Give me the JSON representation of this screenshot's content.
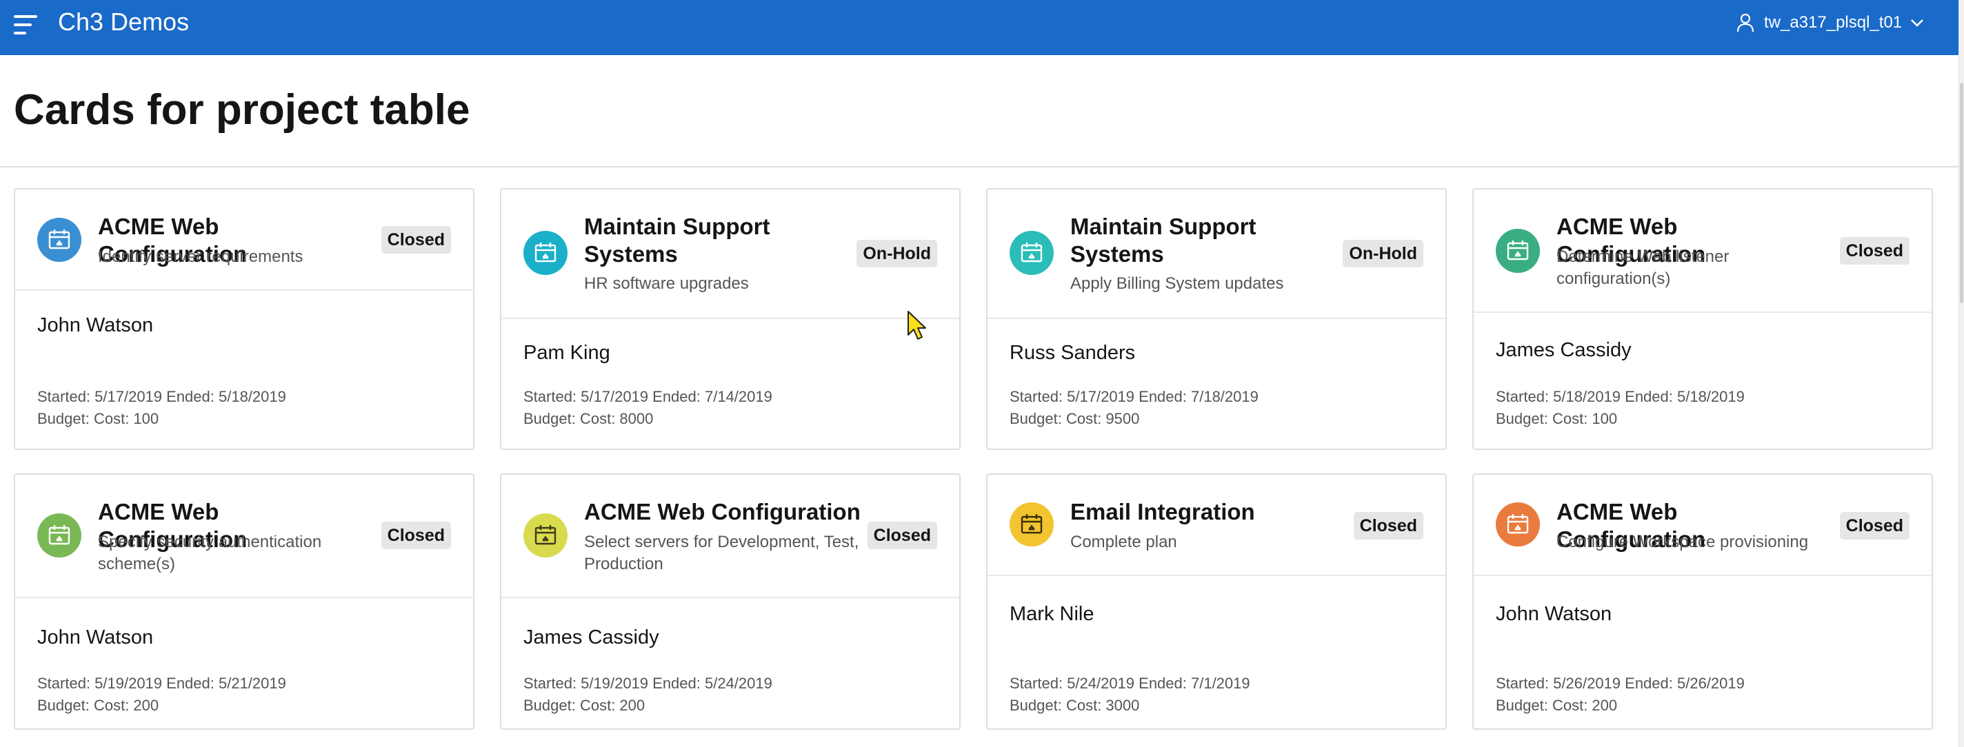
{
  "header": {
    "app_title": "Ch3 Demos",
    "username": "tw_a317_plsql_t01",
    "brand_color": "#1a6ac9"
  },
  "page": {
    "title": "Cards for project table"
  },
  "cards": [
    {
      "title": "ACME Web Configuration",
      "subtitle": "Identify server requirements",
      "status": "Closed",
      "person": "John Watson",
      "dates": "Started: 5/17/2019 Ended: 5/18/2019",
      "budget": "Budget: Cost: 100",
      "icon_color": "#3a8fd3",
      "icon": "calendar-icon"
    },
    {
      "title": "Maintain Support Systems",
      "subtitle": "HR software upgrades",
      "status": "On-Hold",
      "person": "Pam King",
      "dates": "Started: 5/17/2019 Ended: 7/14/2019",
      "budget": "Budget: Cost: 8000",
      "icon_color": "#1ab0c9",
      "icon": "calendar-icon"
    },
    {
      "title": "Maintain Support Systems",
      "subtitle": "Apply Billing System updates",
      "status": "On-Hold",
      "person": "Russ Sanders",
      "dates": "Started: 5/17/2019 Ended: 7/18/2019",
      "budget": "Budget: Cost: 9500",
      "icon_color": "#2bbdb8",
      "icon": "calendar-icon"
    },
    {
      "title": "ACME Web Configuration",
      "subtitle": "Determine Web listener configuration(s)",
      "status": "Closed",
      "person": "James Cassidy",
      "dates": "Started: 5/18/2019 Ended: 5/18/2019",
      "budget": "Budget: Cost: 100",
      "icon_color": "#3aae82",
      "icon": "calendar-icon"
    },
    {
      "title": "ACME Web Configuration",
      "subtitle": "Specify security authentication scheme(s)",
      "status": "Closed",
      "person": "John Watson",
      "dates": "Started: 5/19/2019 Ended: 5/21/2019",
      "budget": "Budget: Cost: 200",
      "icon_color": "#79b855",
      "icon": "calendar-icon"
    },
    {
      "title": "ACME Web Configuration",
      "subtitle": "Select servers for Development, Test, Production",
      "status": "Closed",
      "person": "James Cassidy",
      "dates": "Started: 5/19/2019 Ended: 5/24/2019",
      "budget": "Budget: Cost: 200",
      "icon_color": "#d9da4e",
      "icon": "calendar-icon"
    },
    {
      "title": "Email Integration",
      "subtitle": "Complete plan",
      "status": "Closed",
      "person": "Mark Nile",
      "dates": "Started: 5/24/2019 Ended: 7/1/2019",
      "budget": "Budget: Cost: 3000",
      "icon_color": "#f2c430",
      "icon": "calendar-icon"
    },
    {
      "title": "ACME Web Configuration",
      "subtitle": "Configure Workspace provisioning",
      "status": "Closed",
      "person": "John Watson",
      "dates": "Started: 5/26/2019 Ended: 5/26/2019",
      "budget": "Budget: Cost: 200",
      "icon_color": "#ea7b3e",
      "icon": "calendar-icon"
    }
  ]
}
